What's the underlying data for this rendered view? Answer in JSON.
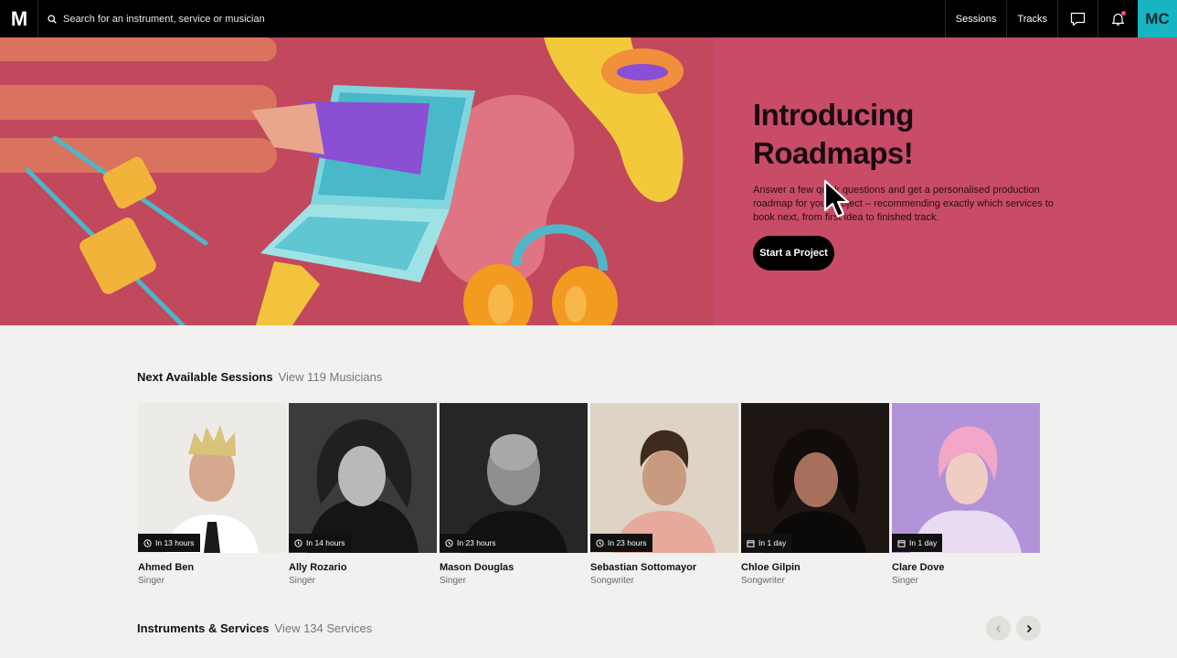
{
  "nav": {
    "logo": "M",
    "search_placeholder": "Search for an instrument, service or musician",
    "links": [
      "Sessions",
      "Tracks"
    ],
    "avatar_initials": "MC"
  },
  "hero": {
    "title_line1": "Introducing",
    "title_line2": "Roadmaps!",
    "description": "Answer a few quick questions and get a personalised production roadmap for your project – recommending exactly which services to book next, from first idea to finished track.",
    "cta_label": "Start a Project"
  },
  "sessions": {
    "title": "Next Available Sessions",
    "link": "View 119 Musicians",
    "cards": [
      {
        "name": "Ahmed Ben",
        "role": "Singer",
        "availability": "In 13 hours",
        "icon": "clock-icon"
      },
      {
        "name": "Ally Rozario",
        "role": "Singer",
        "availability": "In 14 hours",
        "icon": "clock-icon"
      },
      {
        "name": "Mason Douglas",
        "role": "Singer",
        "availability": "In 23 hours",
        "icon": "clock-icon"
      },
      {
        "name": "Sebastian Sottomayor",
        "role": "Songwriter",
        "availability": "In 23 hours",
        "icon": "clock-icon"
      },
      {
        "name": "Chloe Gilpin",
        "role": "Songwriter",
        "availability": "In 1 day",
        "icon": "calendar-icon"
      },
      {
        "name": "Clare Dove",
        "role": "Singer",
        "availability": "In 1 day",
        "icon": "calendar-icon"
      }
    ]
  },
  "services": {
    "title": "Instruments & Services",
    "link": "View 134 Services"
  },
  "colors": {
    "hero_bg": "#c84c68",
    "accent": "#19b4c2",
    "nav_bg": "#000000"
  }
}
